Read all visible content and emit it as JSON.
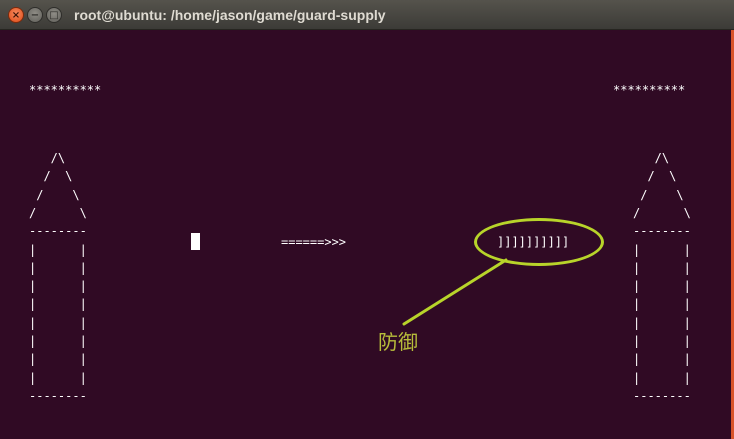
{
  "window": {
    "title": "root@ubuntu: /home/jason/game/guard-supply",
    "close_glyph": "×",
    "minimize_glyph": "−",
    "maximize_glyph": "□"
  },
  "terminal": {
    "stars_left": "**********",
    "stars_right": "**********",
    "arrow": "======>>>",
    "shield": "]]]]]]]]]]"
  },
  "tower_left": {
    "lines": [
      "   /\\",
      "  /  \\",
      " /    \\",
      "/      \\",
      "--------",
      "|      |",
      "|      |",
      "|      |",
      "|      |",
      "|      |",
      "|      |",
      "|      |",
      "|      |",
      "--------"
    ]
  },
  "tower_right": {
    "lines": [
      "   /\\",
      "  /  \\",
      " /    \\",
      "/      \\",
      "--------",
      "|      |",
      "|      |",
      "|      |",
      "|      |",
      "|      |",
      "|      |",
      "|      |",
      "|      |",
      "--------"
    ]
  },
  "annotation": {
    "label": "防御",
    "color": "#b8d42a"
  }
}
